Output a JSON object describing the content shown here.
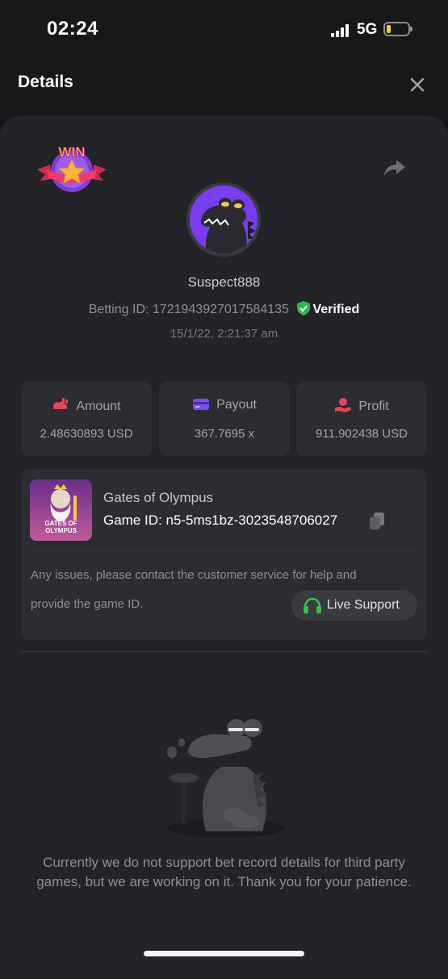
{
  "status_bar": {
    "time": "02:24",
    "network": "5G"
  },
  "header": {
    "title": "Details"
  },
  "user": {
    "name": "Suspect888",
    "betting_id_label": "Betting ID:",
    "betting_id": "1721943927017584135",
    "verified_label": "Verified",
    "datetime": "15/1/22, 2:21:37 am"
  },
  "badge": {
    "text": "WIN"
  },
  "stats": [
    {
      "label": "Amount",
      "value": "2.48630893 USD",
      "icon": "amount-icon",
      "color": "#e8445a"
    },
    {
      "label": "Payout",
      "value": "367.7695 x",
      "icon": "card-icon",
      "color": "#7b4cf2"
    },
    {
      "label": "Profit",
      "value": "911.902438 USD",
      "icon": "profit-icon",
      "color": "#e8445a"
    }
  ],
  "game": {
    "name": "Gates of Olympus",
    "id_label": "Game ID:",
    "id": "n5-5ms1bz-3023548706027",
    "thumb_text": "GATES OF OLYMPUS",
    "notice_line1": "Any issues, please contact the customer service for help and",
    "notice_line2": "provide the game ID.",
    "support_label": "Live Support"
  },
  "empty_state": {
    "message": "Currently we do not support bet record details for third party games, but we are working on it. Thank you for your patience."
  },
  "colors": {
    "verified": "#2fb84f",
    "support_icon": "#35c24a",
    "avatar_bg": "#7a3cf0"
  }
}
